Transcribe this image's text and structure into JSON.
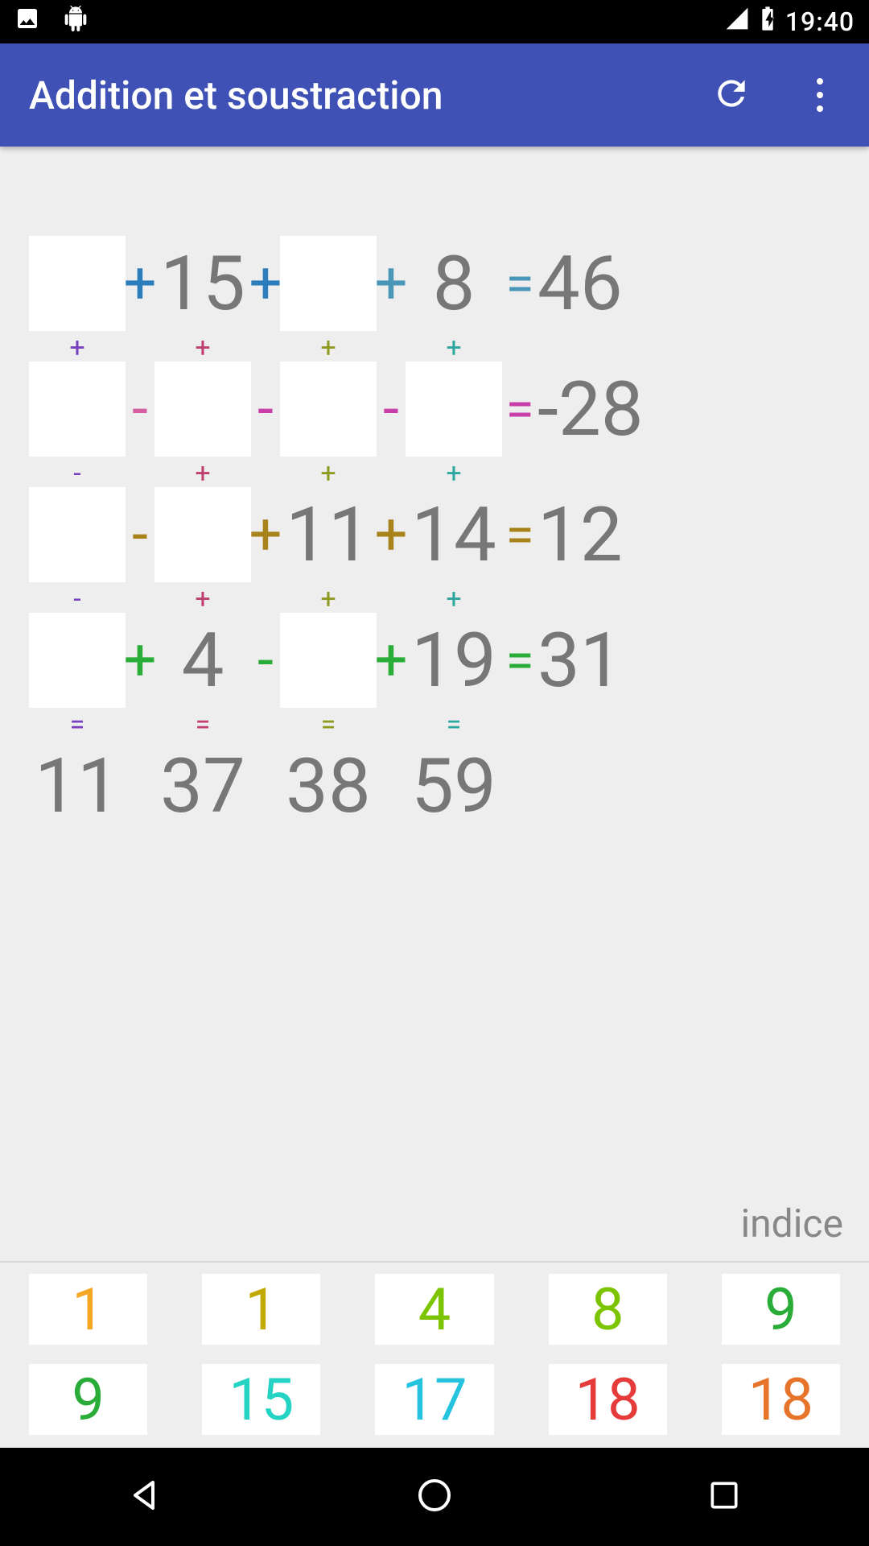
{
  "status_bar": {
    "clock": "19:40"
  },
  "app_bar": {
    "title": "Addition et soustraction"
  },
  "colors": {
    "blue": "#2b7dbc",
    "steel": "#4996b8",
    "pink": "#d65da2",
    "purple": "#7a3fbf",
    "magenta": "#c83fa9",
    "crimson": "#c03f6f",
    "olive": "#8e9a1e",
    "yellow": "#c2a900",
    "darkgold": "#a8831c",
    "teal": "#2ea79e",
    "green": "#2aac38",
    "lime": "#7cc300",
    "orange": "#f5a623",
    "cyan": "#25c3dd",
    "aqua": "#25d3c5",
    "red": "#e63b3b",
    "darkorange": "#e6742a",
    "gray": "#777"
  },
  "puzzle": {
    "rows": [
      {
        "cells": [
          "",
          "15",
          "",
          "8"
        ],
        "inputs": [
          true,
          false,
          true,
          false
        ],
        "ops": [
          "+",
          "+",
          "+"
        ],
        "op_colors": [
          "blue",
          "blue",
          "steel"
        ],
        "eq_color": "steel",
        "result": "46"
      },
      {
        "cells": [
          "",
          "",
          "",
          ""
        ],
        "inputs": [
          true,
          true,
          true,
          true
        ],
        "ops": [
          "-",
          "-",
          "-"
        ],
        "op_colors": [
          "pink",
          "magenta",
          "magenta"
        ],
        "eq_color": "magenta",
        "result": "-28"
      },
      {
        "cells": [
          "",
          "",
          "11",
          "14"
        ],
        "inputs": [
          true,
          true,
          false,
          false
        ],
        "ops": [
          "-",
          "+",
          "+"
        ],
        "op_colors": [
          "darkgold",
          "darkgold",
          "darkgold"
        ],
        "eq_color": "darkgold",
        "result": "12"
      },
      {
        "cells": [
          "",
          "4",
          "",
          "19"
        ],
        "inputs": [
          true,
          false,
          true,
          false
        ],
        "ops": [
          "+",
          "-",
          "+"
        ],
        "op_colors": [
          "green",
          "green",
          "green"
        ],
        "eq_color": "green",
        "result": "31"
      }
    ],
    "column_connectors": [
      {
        "ops": [
          "+",
          "+",
          "+",
          "+"
        ],
        "colors": [
          "purple",
          "crimson",
          "olive",
          "teal"
        ]
      },
      {
        "ops": [
          "-",
          "+",
          "+",
          "+"
        ],
        "colors": [
          "purple",
          "crimson",
          "olive",
          "teal"
        ]
      },
      {
        "ops": [
          "-",
          "+",
          "+",
          "+"
        ],
        "colors": [
          "purple",
          "crimson",
          "olive",
          "teal"
        ]
      }
    ],
    "column_eq_colors": [
      "purple",
      "crimson",
      "olive",
      "teal"
    ],
    "column_results": [
      "11",
      "37",
      "38",
      "59"
    ]
  },
  "indice_label": "indice",
  "tiles": [
    {
      "label": "1",
      "color": "orange"
    },
    {
      "label": "1",
      "color": "yellow"
    },
    {
      "label": "4",
      "color": "lime"
    },
    {
      "label": "8",
      "color": "lime"
    },
    {
      "label": "9",
      "color": "green"
    },
    {
      "label": "9",
      "color": "green"
    },
    {
      "label": "15",
      "color": "aqua"
    },
    {
      "label": "17",
      "color": "cyan"
    },
    {
      "label": "18",
      "color": "red"
    },
    {
      "label": "18",
      "color": "darkorange"
    }
  ]
}
